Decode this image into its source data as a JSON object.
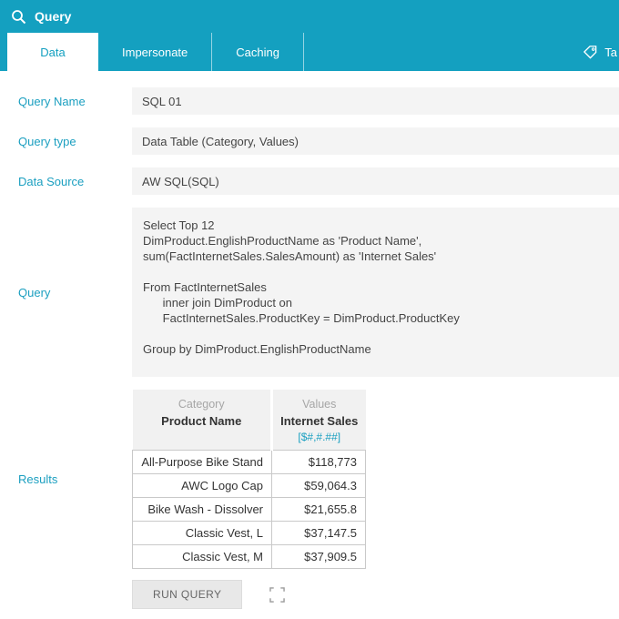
{
  "colors": {
    "accent": "#14a0c0",
    "format_link": "#189fc0"
  },
  "header": {
    "title": "Query"
  },
  "tabs": [
    {
      "label": "Data",
      "active": true
    },
    {
      "label": "Impersonate",
      "active": false
    },
    {
      "label": "Caching",
      "active": false
    }
  ],
  "tags": {
    "label": "Ta"
  },
  "form": {
    "query_name": {
      "label": "Query Name",
      "value": "SQL 01"
    },
    "query_type": {
      "label": "Query type",
      "value": "Data Table (Category, Values)"
    },
    "data_source": {
      "label": "Data Source",
      "value": "AW SQL(SQL)"
    },
    "query": {
      "label": "Query",
      "value": "Select Top 12\nDimProduct.EnglishProductName as 'Product Name',\nsum(FactInternetSales.SalesAmount) as 'Internet Sales'\n\nFrom FactInternetSales\n      inner join DimProduct on\n      FactInternetSales.ProductKey = DimProduct.ProductKey\n\nGroup by DimProduct.EnglishProductName"
    },
    "results": {
      "label": "Results"
    }
  },
  "results_table": {
    "columns": [
      {
        "group": "Category",
        "name": "Product Name",
        "format": ""
      },
      {
        "group": "Values",
        "name": "Internet Sales",
        "format": "[$#,#.##]"
      }
    ],
    "rows": [
      [
        "All-Purpose Bike Stand",
        "$118,773"
      ],
      [
        "AWC Logo Cap",
        "$59,064.3"
      ],
      [
        "Bike Wash - Dissolver",
        "$21,655.8"
      ],
      [
        "Classic Vest, L",
        "$37,147.5"
      ],
      [
        "Classic Vest, M",
        "$37,909.5"
      ]
    ]
  },
  "actions": {
    "run_query_label": "RUN QUERY"
  }
}
